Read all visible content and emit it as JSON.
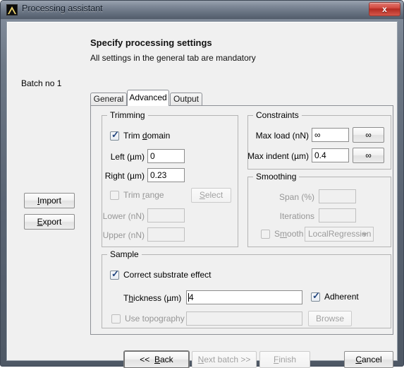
{
  "window": {
    "title": "Processing assistant",
    "app_icon": "triangle-icon",
    "close_label": "x"
  },
  "header": {
    "title": "Specify processing settings",
    "subtitle": "All settings in the general tab are mandatory"
  },
  "sidebar": {
    "batch_label": "Batch no 1",
    "import_label": "Import",
    "export_label": "Export"
  },
  "tabs": [
    {
      "label": "General",
      "selected": false
    },
    {
      "label": "Advanced",
      "selected": true
    },
    {
      "label": "Output",
      "selected": false
    }
  ],
  "trimming": {
    "legend": "Trimming",
    "trim_domain_label": "Trim domain",
    "trim_domain_checked": true,
    "left_label": "Left (µm)",
    "left_value": "0",
    "right_label": "Right (µm)",
    "right_value": "0.23",
    "trim_range_label": "Trim range",
    "trim_range_checked": false,
    "select_label": "Select",
    "lower_label": "Lower (nN)",
    "lower_value": "",
    "upper_label": "Upper (nN)",
    "upper_value": ""
  },
  "constraints": {
    "legend": "Constraints",
    "max_load_label": "Max load (nN)",
    "max_load_value": "∞",
    "max_load_button": "∞",
    "max_indent_label": "Max indent (µm)",
    "max_indent_value": "0.4",
    "max_indent_button": "∞"
  },
  "smoothing": {
    "legend": "Smoothing",
    "span_label": "Span (%)",
    "span_value": "",
    "iterations_label": "Iterations",
    "iterations_value": "",
    "smooth_label": "Smooth",
    "smooth_checked": false,
    "method_value": "LocalRegression"
  },
  "sample": {
    "legend": "Sample",
    "correct_substrate_label": "Correct substrate effect",
    "correct_substrate_checked": true,
    "thickness_label": "Thickness (µm)",
    "thickness_value": "4",
    "adherent_label": "Adherent",
    "adherent_checked": true,
    "use_topography_label": "Use topography",
    "use_topography_checked": false,
    "topography_path": "",
    "browse_label": "Browse"
  },
  "footer": {
    "back_label": "<<  Back",
    "next_batch_label": "Next batch  >>",
    "finish_label": "Finish",
    "cancel_label": "Cancel"
  },
  "colors": {
    "accent_check": "#21457f",
    "close_button": "#d1483e",
    "window_frame": "#5a6473",
    "client_bg": "#f0f0f0"
  }
}
